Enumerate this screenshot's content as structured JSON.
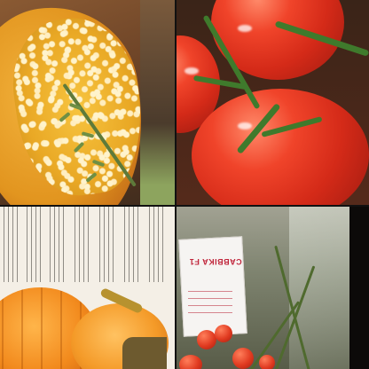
{
  "tiles": [
    {
      "subject": "stuffed-squash"
    },
    {
      "subject": "tomatoes-on-vine"
    },
    {
      "subject": "pumpkin-magazine-page"
    },
    {
      "subject": "greenhouse-tomato-label"
    }
  ],
  "label_card": {
    "title": "CABBIKA F1"
  },
  "colors": {
    "squash_orange": "#e9a825",
    "tomato_red": "#d42a18",
    "stem_green": "#3f7a2c",
    "pumpkin_orange": "#f28a1d",
    "label_red": "#c0243a"
  }
}
